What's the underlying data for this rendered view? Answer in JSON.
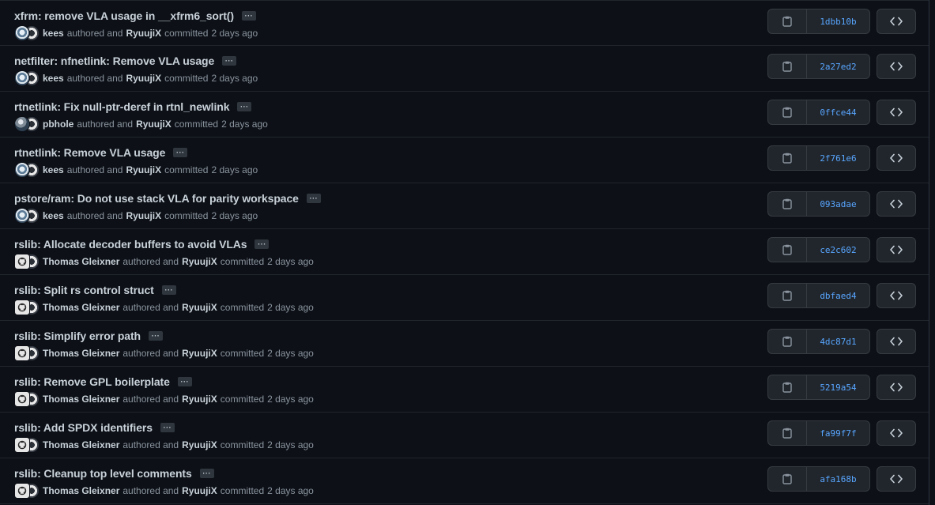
{
  "common": {
    "ellipsis": "···",
    "authored_text": "authored and",
    "committed_text": "committed"
  },
  "commits": [
    {
      "title": "xfrm: remove VLA usage in __xfrm6_sort()",
      "author": "kees",
      "committer": "RyuujiX",
      "time": "2 days ago",
      "sha": "1dbb10b",
      "avatar": "kees"
    },
    {
      "title": "netfilter: nfnetlink: Remove VLA usage",
      "author": "kees",
      "committer": "RyuujiX",
      "time": "2 days ago",
      "sha": "2a27ed2",
      "avatar": "kees"
    },
    {
      "title": "rtnetlink: Fix null-ptr-deref in rtnl_newlink",
      "author": "pbhole",
      "committer": "RyuujiX",
      "time": "2 days ago",
      "sha": "0ffce44",
      "avatar": "pbhole"
    },
    {
      "title": "rtnetlink: Remove VLA usage",
      "author": "kees",
      "committer": "RyuujiX",
      "time": "2 days ago",
      "sha": "2f761e6",
      "avatar": "kees"
    },
    {
      "title": "pstore/ram: Do not use stack VLA for parity workspace",
      "author": "kees",
      "committer": "RyuujiX",
      "time": "2 days ago",
      "sha": "093adae",
      "avatar": "kees"
    },
    {
      "title": "rslib: Allocate decoder buffers to avoid VLAs",
      "author": "Thomas Gleixner",
      "committer": "RyuujiX",
      "time": "2 days ago",
      "sha": "ce2c602",
      "avatar": "thomas"
    },
    {
      "title": "rslib: Split rs control struct",
      "author": "Thomas Gleixner",
      "committer": "RyuujiX",
      "time": "2 days ago",
      "sha": "dbfaed4",
      "avatar": "thomas"
    },
    {
      "title": "rslib: Simplify error path",
      "author": "Thomas Gleixner",
      "committer": "RyuujiX",
      "time": "2 days ago",
      "sha": "4dc87d1",
      "avatar": "thomas"
    },
    {
      "title": "rslib: Remove GPL boilerplate",
      "author": "Thomas Gleixner",
      "committer": "RyuujiX",
      "time": "2 days ago",
      "sha": "5219a54",
      "avatar": "thomas"
    },
    {
      "title": "rslib: Add SPDX identifiers",
      "author": "Thomas Gleixner",
      "committer": "RyuujiX",
      "time": "2 days ago",
      "sha": "fa99f7f",
      "avatar": "thomas"
    },
    {
      "title": "rslib: Cleanup top level comments",
      "author": "Thomas Gleixner",
      "committer": "RyuujiX",
      "time": "2 days ago",
      "sha": "afa168b",
      "avatar": "thomas"
    }
  ],
  "colors": {
    "background": "#0d1117",
    "link": "#58a6ff",
    "muted": "#8b949e",
    "text": "#c9d1d9"
  }
}
